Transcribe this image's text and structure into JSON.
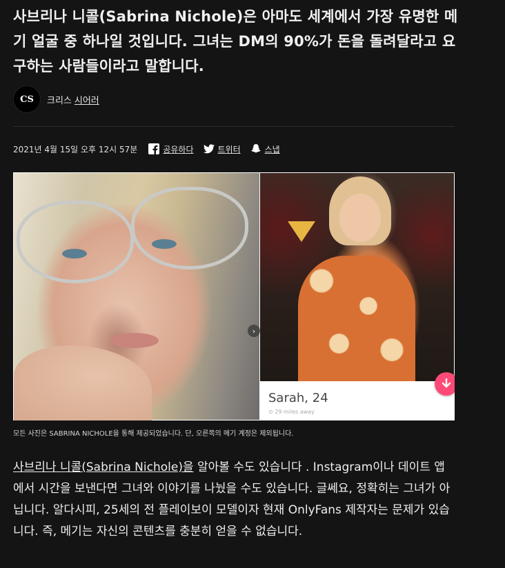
{
  "article": {
    "headline": "사브리나 니콜(Sabrina Nichole)은 아마도 세계에서 가장 유명한 메기 얼굴 중 하나일 것입니다. 그녀는 DM의 90%가 돈을 돌려달라고 요구하는 사람들이라고 말합니다."
  },
  "byline": {
    "avatar_initials": "CS",
    "author_first": "크리스",
    "author_last": "시어러"
  },
  "meta": {
    "date": "2021년 4월 15일 오후 12시 57분",
    "share_facebook": "공유하다",
    "share_twitter": "트위터",
    "share_snapchat": "스냅"
  },
  "icons": {
    "facebook": "facebook-icon",
    "twitter": "twitter-icon",
    "snapchat": "snapchat-icon",
    "next": "chevron-right-icon",
    "download": "arrow-down-icon"
  },
  "photo": {
    "profile_name": "Sarah, 24",
    "profile_distance": "29 miles away"
  },
  "caption": "모든 사진은 SABRINA NICHOLE을 통해 제공되었습니다. 단, 오른쪽의 메기 계정은 제외됩니다.",
  "body": {
    "link_text": "사브리나 니콜(Sabrina Nichole)을",
    "rest": " 알아볼 수도 있습니다 . Instagram이나 데이트 앱에서 시간을 보낸다면 그녀와 이야기를 나눴을 수도 있습니다. 글쎄요, 정확히는 그녀가 아닙니다. 알다시피, 25세의 전 플레이보이 모델이자 현재 OnlyFans 제작자는 문제가 있습니다. 즉, 메기는 자신의 콘텐츠를 충분히 얻을 수 없습니다."
  },
  "colors": {
    "background": "#141414",
    "text": "#eeeeee",
    "accent_pink": "#ff4a78"
  }
}
